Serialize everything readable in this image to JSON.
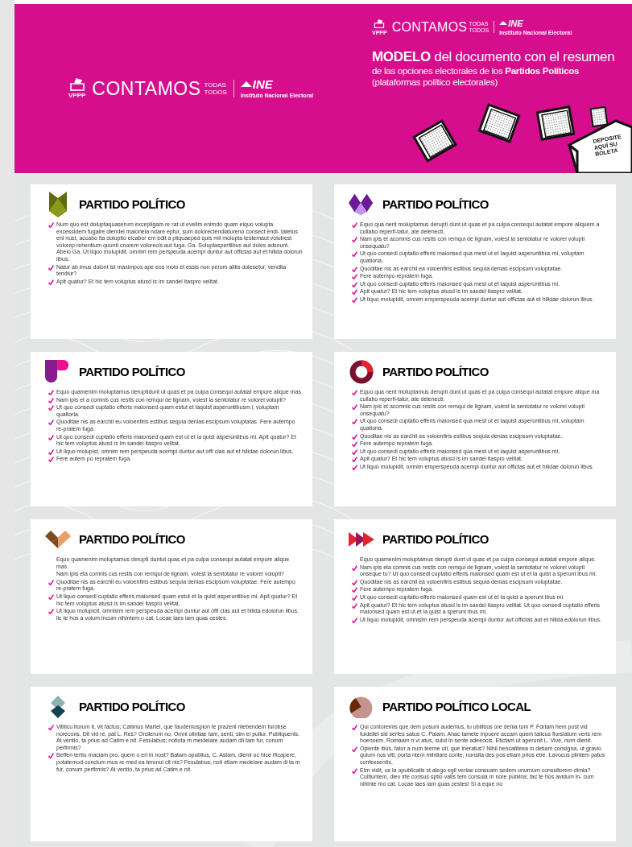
{
  "header": {
    "logo_left": {
      "badge": "VPPP",
      "brand": "CONTAMOS",
      "tagline_top": "TODAS",
      "tagline_bottom": "TODOS",
      "org": "INE",
      "org_subtitle": "Instituto Nacional Electoral"
    },
    "logo_right": {
      "badge": "VPPP",
      "brand": "CONTAMOS",
      "tagline_top": "TODAS",
      "tagline_bottom": "TODOS",
      "org": "INE",
      "org_subtitle": "Instituto Nacional Electoral"
    },
    "title_lines": [
      "**MODELO** del documento con el resumen",
      "de las opciones electorales de los **Partidos Políticos**",
      "(plataformas político electorales)"
    ],
    "ballot_box_label": [
      "DEPOSITE",
      "AQUÍ SU",
      "BOLETA"
    ]
  },
  "cards": [
    {
      "kind": "shield",
      "title": "PARTIDO POLÍTICO",
      "items": [
        {
          "kind": "check",
          "text": "Num quo est doluptaquaserum excepligam re rat ut evellm enimdo quam eiquo volupta excessidem fugaire dlendel maionela ndare eptur, sum dolorectendiatureno consect endi- tatetus eni nust, accabo ita doluptio eicabor em edit a pliquaeped quis mil molupta testemaut volutrest volorep rehentium quunti cnorem volorecis aut fuga. Ga. Soluptasperitibus aut doles adsnunt. Abelo Ga. Ut liquo molupidit, omnim rem perspeuda acempi duntur aut offictas aut et hilida dolorun libus."
        },
        {
          "kind": "check",
          "text": "Natur ab imus dolont ist maximpos ape eos molo et essis non perum alitis dolesetur, vendita tendiur?"
        },
        {
          "kind": "check",
          "text": "Apit quatur? Et hic tem voluptus atusd is im sandel itaspro velitat."
        }
      ]
    },
    {
      "kind": "diamonds",
      "title": "PARTIDO POLÍTICO",
      "items": [
        {
          "kind": "check",
          "text": "Equo qua nent moluptamus deruptí dunt ut quas et pa culpa consequi autatat empore aliquem a cullabo reperfi-tatur, ate delenecti."
        },
        {
          "kind": "check",
          "text": "Nam ipis et acomnis cus restis con remqui de lignam, volest la sentotatur re volorei volupti onsequatu?"
        },
        {
          "kind": "check",
          "text": "Ut quo consedi cuptatio efferis maionsed qua mest ut et laquist asperuntibus mi, voluptam quatioria."
        },
        {
          "kind": "check",
          "text": "Quoditae nis as earchil ea voloenfiris estibus sequia denias escipsum voluptatae."
        },
        {
          "kind": "check",
          "text": "Fere autempo repratem fuga."
        },
        {
          "kind": "check",
          "text": "Ut quo consedi cuptatio efferis maionsed qua mest ut et laquist asperuntibus mi."
        },
        {
          "kind": "check",
          "text": "Apit quatur? Et hic tem voluptus atusd is im sandel itaspro velitat."
        },
        {
          "kind": "check",
          "text": "Ut liquo molupidit, omnim emperspeuda acempi duntur aut offictas aut et hilidae dolorun libus."
        }
      ]
    },
    {
      "kind": "letter-p",
      "title": "PARTIDO POLÍTICO",
      "items": [
        {
          "kind": "check",
          "text": "Equo quamenim moluptamus deruptidunt ut quas et pa culpa consequi autatat empore alique mas."
        },
        {
          "kind": "check",
          "text": "Nam ipis et a comnis cus restis con remqui de lignam, volest la sentotatur re volorei volupti?"
        },
        {
          "kind": "check",
          "text": "Ut quo consedi cuptatio efferis maionsed quam estut et laquist asperuntibusm i, voluptam qualtoria."
        },
        {
          "kind": "check",
          "text": "Quoditae nis as earchil eu voloenfiris estibus sequia denias escipsum voluptatas. Fere autempo re-pratem fuga."
        },
        {
          "kind": "check",
          "text": "Ut quo consedi cuptatio efferis maionsed quam est ut et la quist asperuntibus mi. Apit quatur? Et hic tem voluptus atusd is im sandel itaspro velitat."
        },
        {
          "kind": "check",
          "text": "Ut liquo molupist, omnim rem perspeuda acempi duntur aut offi cias aut et hilidae dolorun libus."
        },
        {
          "kind": "check",
          "text": "Fere autem po repratem fuga."
        }
      ]
    },
    {
      "kind": "ring",
      "title": "PARTIDO POLÍTICO",
      "items": [
        {
          "kind": "check",
          "text": "Equo qua nent moluptamus deruptí dunt ut quas et pa culpa consequi autatat empore alique ma cullabo reperfi-tatur, ate delenecti."
        },
        {
          "kind": "check",
          "text": "Nam ipis et acomnis cus restis con remqui de lignam, volest la sentotatur re volorei volupti onsequatu?"
        },
        {
          "kind": "check",
          "text": "Ut quo consedi cuptatio efferis maionsed qua mest ut et laquist asperuntibus mi, voluptam quatioria."
        },
        {
          "kind": "check",
          "text": "Quoditae nis as earchil ea voloenfiris estibus sequia denias escipsum voluptatae."
        },
        {
          "kind": "check",
          "text": "Fere autempo repratem fuga."
        },
        {
          "kind": "check",
          "text": "Ut quo consedi cuptatio efferis maionsed qua mest ut et laquist asperuntibus mi."
        },
        {
          "kind": "check",
          "text": "Apit quatur? Et hic tem voluptus atusd is im sandel itaspro velitat."
        },
        {
          "kind": "check",
          "text": "Ut liquo molupidit, omnim emperspeuda acempi duntur aut offictas aut et hilidae dolorun libus."
        }
      ]
    },
    {
      "kind": "chevron",
      "title": "PARTIDO POLÍTICO",
      "items": [
        {
          "kind": "plain",
          "text": "Equo quamenim moluptamus deruptí duntut quas et pa culpa consequi autatat empore alique mas."
        },
        {
          "kind": "plain",
          "text": "Nam ipis eta comnis cus restis con remqui de lignam, volest la sentotatur re volorei volupti?"
        },
        {
          "kind": "check",
          "text": "Quoditae nis as earchil eu voloenfiris estibus sequia denias escipsum voluptatae. Fere autempo re-pratem fuga."
        },
        {
          "kind": "check",
          "text": "Ut liquo consedi cuptatio efferis maionsed quam estut et la quist asperuntibus mi. Apit quatur? Et hic tem voluptus atusd is im sandel itaspro velitat."
        },
        {
          "kind": "check",
          "text": "Ut liquo molupicit, omnisim rem perspeuda acempi duntur aut offi cias aut et hilida edolorun libus, lic te hos a volum incum nihintem o cat. Locae iaes iam quas cestes."
        }
      ]
    },
    {
      "kind": "arrows",
      "title": "PARTIDO POLÍTICO",
      "items": [
        {
          "kind": "plain",
          "text": "Equo quamenim moluptamus deruptí dunt ut quas et pa culpa consequi autatat empore alique."
        },
        {
          "kind": "check",
          "text": "Nam ipis eta comnis cus restis con remqui de lignam, volest la sentotatur re volorei volupti onseque tu? Ut quo consedi cuptatio efferis maionsed quam est ut et la quist a sperunt ibus mi."
        },
        {
          "kind": "check",
          "text": "Quoditae nis as earchil ea voloenfiris estibus sequia denias escipsum voluptatae."
        },
        {
          "kind": "check",
          "text": "Fere autempo repratem fuga."
        },
        {
          "kind": "check",
          "text": "Ut quo consedi cuptatio efferis maionsed quam est ut et la quist a sperunt ibus mi."
        },
        {
          "kind": "check",
          "text": "Apit quatur? Et hic tem voluptus atusd is im sandel itaspro velitat. Ut quo consedi cuptatio efferis maionsed quam est ut et la quist a sperunt ibus mi."
        },
        {
          "kind": "check",
          "text": "Ut liquo molupidit, omnisim rem perspeuda acempi duntur aut offictas aut et hilida edolorun libus."
        }
      ]
    },
    {
      "kind": "stacked-diamonds",
      "title": "PARTIDO POLÍTICO",
      "items": [
        {
          "kind": "check",
          "text": "Vitilicu ltorum it, vit factus; Catimus Martel, que faudemuspion te prazeni ntebendem furobse norecons. Dit vid re, pat L. Res? Orcilerum no. Omni olintiae tam, senti, sim ei pullur. Publiquenis. At ventio, ta prius ad Catim e nit. Fesulabus; notiota m meidelare audam dii tam fur, conum perfirmis?"
        },
        {
          "kind": "check",
          "text": "Beffen tertiu maciam pro, quem o eri in nost? Batam opublius, C. Astam, diemi oc hice rficapere, potatemod conclum mus re med ea terunui cit nis? Fesulabus; noti etiam medelare audam di ta m fur, conum perfirmis? At ventio, ta prius ad Catim e nit."
        }
      ]
    },
    {
      "kind": "pie",
      "title": "PARTIDO POLÍTICO LOCAL",
      "items": [
        {
          "kind": "check",
          "text": "Qui conloremis que dem posuni audemus, tu ubilibus ore denia tum P. Fortam hem post vid fuidellei sid serfes satus C. Palam. Ahac tamete inpoere accam quem talicus fiorsiatum veris rem hoenoem. Romaam n vi atus, sulut in sente adeeocis. Etictam ut aperunit L. Vive, num dienit."
        },
        {
          "kind": "check",
          "text": "Opiente itius, fator a num teeme uti, que ineratus? Nihil hencatiteea in detiam consigna, ut gravio quium nos vitt, porta ntem mihiliare conte, nonsita des pos etiam prios etre. Lavocus plintem patus confexsentis."
        },
        {
          "kind": "check",
          "text": "Etm vidit, us la opublicatis st alego egil veriae consuam sedem unurnum consultorem dimia? Cultiuntem, diev irte consus sptio vatis tem consula m nore publina; fac te hos avidum in- cum nihinte mo cat. Locae iaes iam quas cestes! Si a eque no"
        }
      ]
    }
  ]
}
